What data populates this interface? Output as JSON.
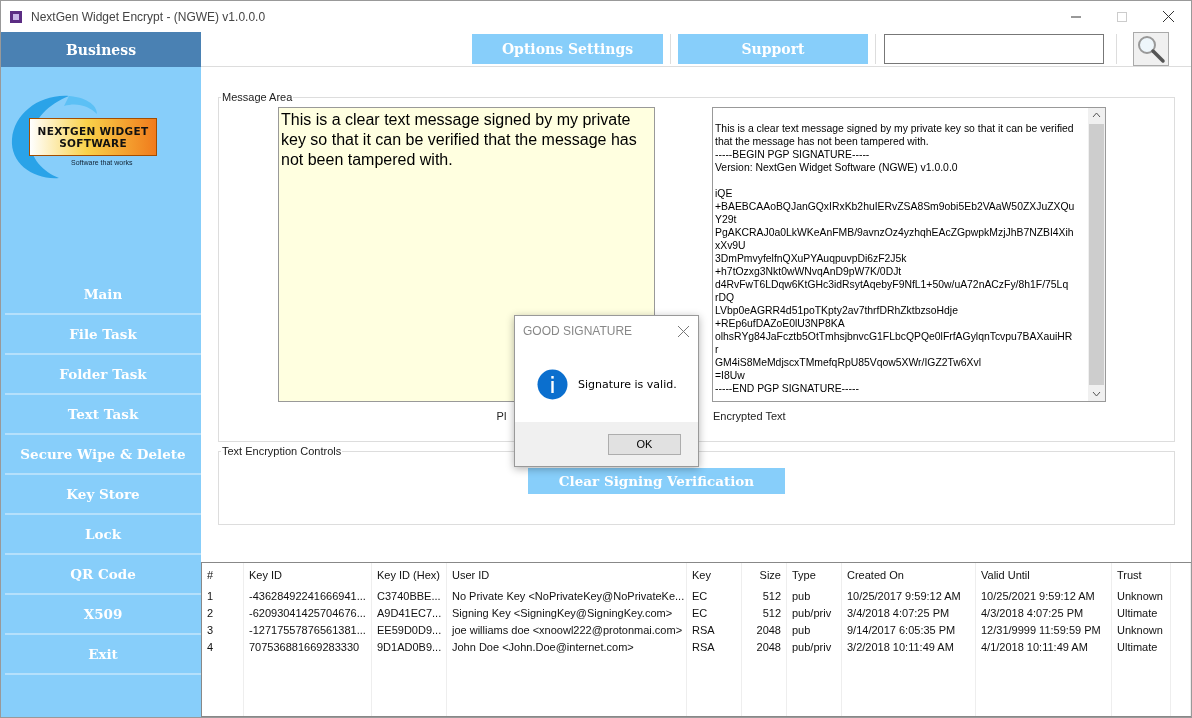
{
  "window": {
    "title": "NextGen Widget Encrypt - (NGWE) v1.0.0.0"
  },
  "sidebar": {
    "header": "Business",
    "logo": {
      "line_1": "NEXTGEN WIDGET",
      "line_2": "SOFTWARE",
      "tagline": "Software that works"
    },
    "items": [
      {
        "label": "Main"
      },
      {
        "label": "File Task"
      },
      {
        "label": "Folder Task"
      },
      {
        "label": "Text Task"
      },
      {
        "label": "Secure Wipe & Delete"
      },
      {
        "label": "Key Store"
      },
      {
        "label": "Lock"
      },
      {
        "label": "QR Code"
      },
      {
        "label": "X509"
      },
      {
        "label": "Exit"
      }
    ]
  },
  "toolbar": {
    "buttons": [
      "Options Settings",
      "Support"
    ]
  },
  "message_area": {
    "title": "Message Area",
    "plain_text": "This is a clear text message signed by my private key so that it can be verified that the message has not been tampered with.",
    "plain_label": "Pl",
    "encrypted_blocks": [
      [
        "This is a clear text message signed by my private key so that it can be verified",
        "that the message has not been tampered with.",
        "-----BEGIN PGP SIGNATURE-----",
        "Version: NextGen Widget Software (NGWE) v1.0.0.0"
      ],
      [
        "iQE",
        "+BAEBCAAoBQJanGQxIRxKb2huIERvZSA8Sm9obi5Eb2VAaW50ZXJuZXQu",
        "Y29t",
        "PgAKCRAJ0a0LkWKeAnFMB/9avnzOz4yzhqhEAcZGpwpkMzjJhB7NZBI4Xih",
        "xXv9U",
        "3DmPmvyfelfnQXuPYAuqpuvpDi6zF2J5k",
        "+h7tOzxg3Nkt0wWNvqAnD9pW7K/0DJt",
        "d4RvFwT6LDqw6KtGHc3idRsytAqebyF9NfL1+50w/uA72nACzFy/8h1F/75Lq",
        "rDQ",
        "LVbp0eAGRR4d51poTKpty2av7thrfDRhZktbzsoHdje",
        "+REp6ufDAZoE0lU3NP8KA",
        "olhsRYg84JaFcztb5OtTmhsjbnvcG1FLbcQPQe0lFrfAGylqnTcvpu7BAXauiHR",
        "r",
        "GM4iS8MeMdjscxTMmefqRpU85Vqow5XWr/IGZ2Tw6Xvl",
        "=I8Uw",
        "-----END PGP SIGNATURE-----"
      ]
    ],
    "encrypted_label": "Encrypted Text"
  },
  "controls": {
    "title": "Text Encryption Controls",
    "button": "Clear Signing Verification"
  },
  "table": {
    "columns": [
      "#",
      "Key ID",
      "Key ID (Hex)",
      "User ID",
      "Key",
      "Size",
      "Type",
      "Created On",
      "Valid Until",
      "Trust"
    ],
    "rows": [
      [
        "1",
        "-43628492241666941...",
        "C3740BBE...",
        "No Private Key <NoPrivateKey@NoPrivateKe...",
        "EC",
        "512",
        "pub",
        "10/25/2017 9:59:12 AM",
        "10/25/2021 9:59:12 AM",
        "Unknown"
      ],
      [
        "2",
        "-62093041425704676...",
        "A9D41EC7...",
        "Signing Key <SigningKey@SigningKey.com>",
        "EC",
        "512",
        "pub/priv",
        "3/4/2018 4:07:25 PM",
        "4/3/2018 4:07:25 PM",
        "Ultimate"
      ],
      [
        "3",
        "-12717557876561381...",
        "EE59D0D9...",
        "joe williams doe <xnoowl222@protonmai.com>",
        "RSA",
        "2048",
        "pub",
        "9/14/2017 6:05:35 PM",
        "12/31/9999 11:59:59 PM",
        "Unknown"
      ],
      [
        "4",
        "707536881669283330",
        "9D1AD0B9...",
        "John Doe <John.Doe@internet.com>",
        "RSA",
        "2048",
        "pub/priv",
        "3/2/2018 10:11:49 AM",
        "4/1/2018 10:11:49 AM",
        "Ultimate"
      ]
    ]
  },
  "dialog": {
    "title": "GOOD SIGNATURE",
    "message": "Signature is valid.",
    "button": "OK"
  }
}
